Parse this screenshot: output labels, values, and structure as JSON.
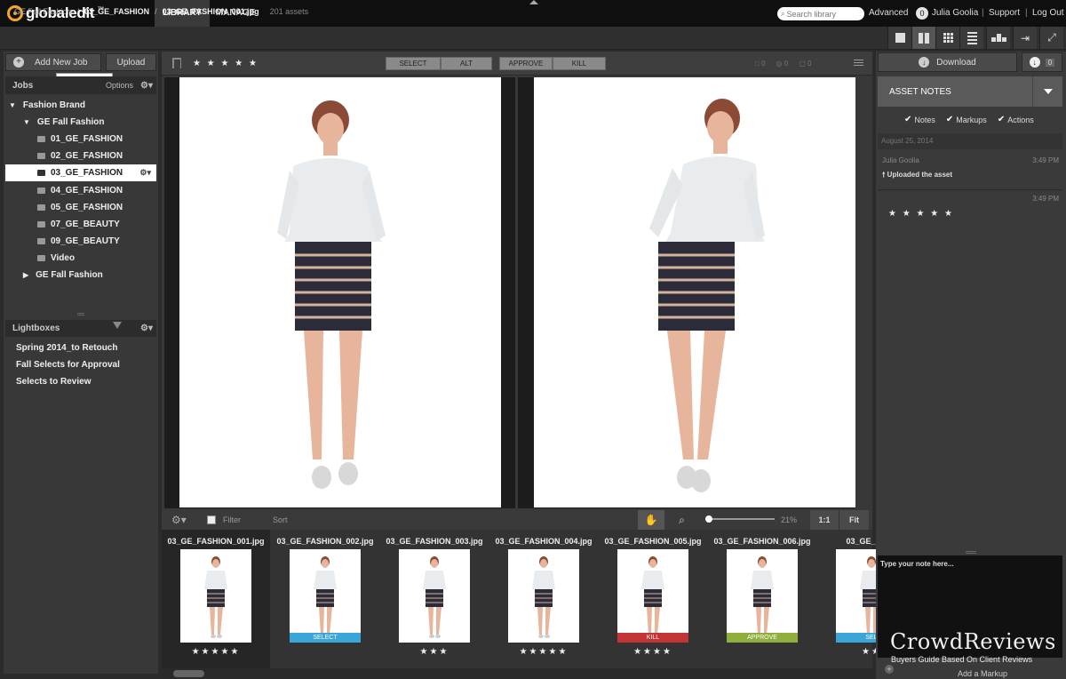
{
  "app": {
    "logo": "globaledit",
    "tm": "™"
  },
  "nav": {
    "tabs": [
      "LIBRARY",
      "MANAGE"
    ],
    "active": "LIBRARY"
  },
  "header": {
    "search_placeholder": "Search library",
    "advanced": "Advanced",
    "notif_count": "0",
    "user": "Julia Goolia",
    "support": "Support",
    "logout": "Log Out",
    "sep": "|"
  },
  "breadcrumb": {
    "root": "GE Fall Fashion",
    "job": "03_GE_FASHION",
    "file": "03_GE_FASHION_001.jpg",
    "count": "201 assets",
    "sep": "/"
  },
  "left": {
    "add_job": "Add New Job",
    "upload": "Upload",
    "tooltip": "Create New Job",
    "jobs_title": "Jobs",
    "options": "Options",
    "tree": [
      {
        "label": "Fashion Brand",
        "level": 0,
        "icon": "caret-down-icon"
      },
      {
        "label": "GE Fall Fashion",
        "level": 1,
        "icon": "caret-down-icon"
      },
      {
        "label": "01_GE_FASHION",
        "level": 2,
        "icon": "folder-icon"
      },
      {
        "label": "02_GE_FASHION",
        "level": 2,
        "icon": "folder-icon"
      },
      {
        "label": "03_GE_FASHION",
        "level": 2,
        "icon": "folder-icon",
        "selected": true
      },
      {
        "label": "04_GE_FASHION",
        "level": 2,
        "icon": "folder-icon"
      },
      {
        "label": "05_GE_FASHION",
        "level": 2,
        "icon": "folder-icon"
      },
      {
        "label": "07_GE_BEAUTY",
        "level": 2,
        "icon": "folder-icon"
      },
      {
        "label": "09_GE_BEAUTY",
        "level": 2,
        "icon": "folder-icon"
      },
      {
        "label": "Video",
        "level": 2,
        "icon": "folder-icon"
      },
      {
        "label": "GE Fall Fashion",
        "level": 1,
        "icon": "caret-right-icon"
      }
    ],
    "lightboxes_title": "Lightboxes",
    "lightboxes": [
      "Spring 2014_to Retouch",
      "Fall Selects for Approval",
      "Selects to Review"
    ]
  },
  "viewer": {
    "stars": "★ ★ ★ ★ ★",
    "buttons": [
      "SELECT",
      "ALT",
      "APPROVE",
      "KILL"
    ],
    "counts": [
      "0",
      "0",
      "0"
    ],
    "filter": "Filter",
    "sort": "Sort",
    "zoom": "21%",
    "zoom_level": 0.21,
    "one_to_one": "1:1",
    "fit": "Fit"
  },
  "thumbs": [
    {
      "name": "03_GE_FASHION_001.jpg",
      "tag": "",
      "stars": "★★★★★"
    },
    {
      "name": "03_GE_FASHION_002.jpg",
      "tag": "SELECT",
      "tagColor": "#3aa6d8",
      "stars": ""
    },
    {
      "name": "03_GE_FASHION_003.jpg",
      "tag": "",
      "stars": "★★★"
    },
    {
      "name": "03_GE_FASHION_004.jpg",
      "tag": "",
      "stars": "★★★★★"
    },
    {
      "name": "03_GE_FASHION_005.jpg",
      "tag": "KILL",
      "tagColor": "#c33434",
      "stars": "★★★★"
    },
    {
      "name": "03_GE_FASHION_006.jpg",
      "tag": "APPROVE",
      "tagColor": "#8fae3c",
      "stars": ""
    },
    {
      "name": "03_GE_FASH",
      "tag": "SEL",
      "tagColor": "#3aa6d8",
      "stars": "★★"
    }
  ],
  "right": {
    "download": "Download",
    "download_count": "0",
    "notes_title": "ASSET NOTES",
    "filters": [
      "Notes",
      "Markups",
      "Actions"
    ],
    "date": "August 25, 2014",
    "note_user": "Julia Goolia",
    "note_time": "3:49 PM",
    "note_text": "Uploaded the asset",
    "note2_time": "3:49 PM",
    "note2_stars": "★ ★ ★ ★ ★",
    "note_placeholder": "Type your note here...",
    "add_markup": "Add a Markup"
  },
  "watermark": {
    "title": "CrowdReviews",
    "subtitle": "Buyers Guide Based On Client Reviews"
  }
}
